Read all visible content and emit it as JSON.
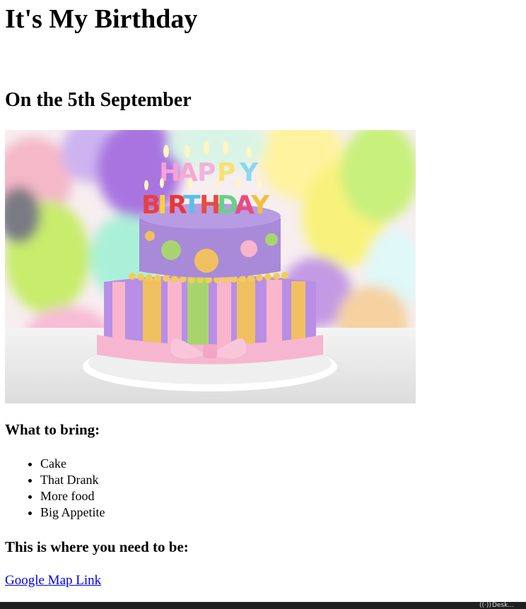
{
  "page": {
    "title": "It's My Birthday",
    "date_heading": "On the 5th September",
    "cake_image": {
      "kind": "photo",
      "lettering": [
        "HAPPY",
        "BIRTHDAY"
      ]
    },
    "bring_heading": "What to bring:",
    "bring_items": [
      "Cake",
      "That Drank",
      "More food",
      "Big Appetite"
    ],
    "where_heading": "This is where you need to be:",
    "map_link_label": "Google Map Link"
  },
  "colors": {
    "link": "#0000ee",
    "text": "#000000",
    "taskbar": "#202020"
  },
  "taskbar": {
    "wifi_icon": "wifi-icon",
    "tray_text": "Desk..."
  }
}
